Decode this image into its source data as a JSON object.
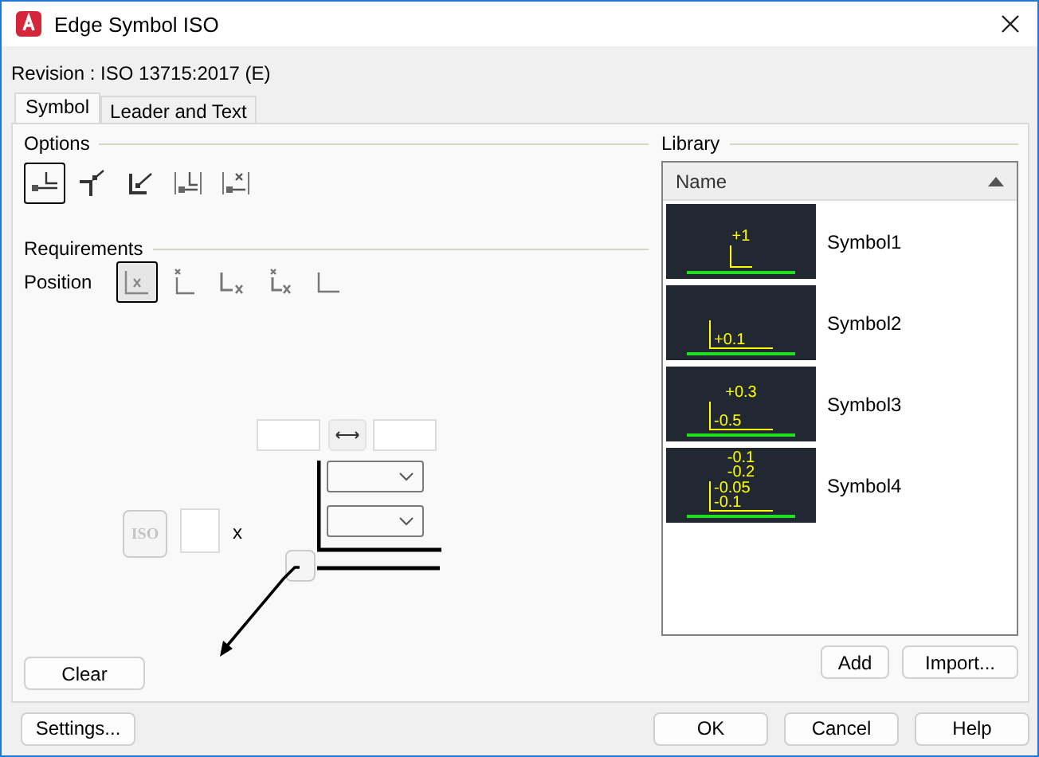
{
  "window": {
    "title": "Edge Symbol ISO"
  },
  "revision": "Revision : ISO 13715:2017 (E)",
  "tabs": [
    {
      "label": "Symbol",
      "selected": true
    },
    {
      "label": "Leader and Text",
      "selected": false
    }
  ],
  "options": {
    "label": "Options",
    "items": [
      {
        "selected": true
      },
      {
        "selected": false
      },
      {
        "selected": false
      },
      {
        "selected": false
      },
      {
        "selected": false
      }
    ]
  },
  "requirements": {
    "label": "Requirements",
    "position_label": "Position",
    "positions": [
      {
        "selected": true
      },
      {
        "selected": false
      },
      {
        "selected": false
      },
      {
        "selected": false
      },
      {
        "selected": false
      }
    ]
  },
  "editor": {
    "iso_button": {
      "label": "ISO",
      "disabled": true
    },
    "multiplier": "x"
  },
  "clear_button": "Clear",
  "library": {
    "label": "Library",
    "column": "Name",
    "rows": [
      {
        "name": "Symbol1",
        "above": [
          "+1"
        ],
        "beside": []
      },
      {
        "name": "Symbol2",
        "above": [],
        "beside": [
          "+0.1"
        ]
      },
      {
        "name": "Symbol3",
        "above": [
          "+0.3"
        ],
        "beside": [
          "-0.5"
        ]
      },
      {
        "name": "Symbol4",
        "above": [
          "-0.1",
          "-0.2"
        ],
        "beside": [
          "-0.05",
          "-0.1"
        ]
      }
    ]
  },
  "library_buttons": [
    "Add",
    "Import..."
  ],
  "footer_left": "Settings...",
  "footer_buttons": [
    "OK",
    "Cancel",
    "Help"
  ]
}
